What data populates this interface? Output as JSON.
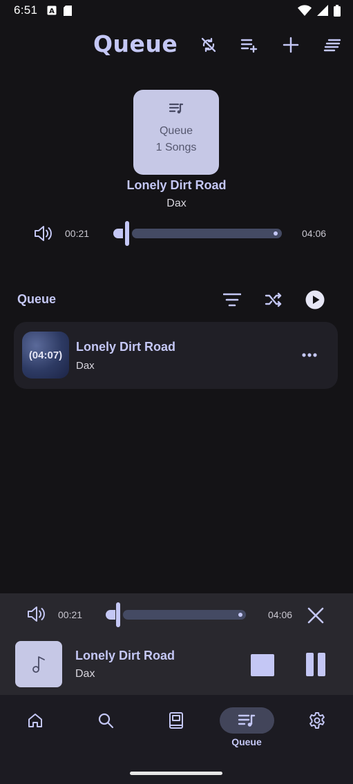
{
  "status_bar": {
    "time": "6:51"
  },
  "header": {
    "title": "Queue",
    "icons": [
      "sync-disabled-icon",
      "playlist-add-icon",
      "plus-icon",
      "sort-lines-icon"
    ]
  },
  "cover": {
    "title": "Queue",
    "subtitle": "1 Songs"
  },
  "now_playing": {
    "title": "Lonely Dirt Road",
    "artist": "Dax",
    "elapsed": "00:21",
    "duration": "04:06",
    "progress_fraction": 0.085
  },
  "queue_section": {
    "title": "Queue"
  },
  "queue_items": [
    {
      "duration_badge": "(04:07)",
      "title": "Lonely Dirt Road",
      "artist": "Dax"
    }
  ],
  "mini_player": {
    "elapsed": "00:21",
    "duration": "04:06",
    "title": "Lonely Dirt Road",
    "artist": "Dax",
    "progress_fraction": 0.085
  },
  "bottom_nav": {
    "items": [
      {
        "icon": "home-icon",
        "label": ""
      },
      {
        "icon": "search-icon",
        "label": ""
      },
      {
        "icon": "library-book-icon",
        "label": ""
      },
      {
        "icon": "queue-music-icon",
        "label": "Queue",
        "active": true
      },
      {
        "icon": "settings-gear-icon",
        "label": ""
      }
    ]
  },
  "colors": {
    "accent": "#c4c7f5",
    "background": "#141316",
    "surface": "#201f26",
    "track": "#444a63"
  }
}
